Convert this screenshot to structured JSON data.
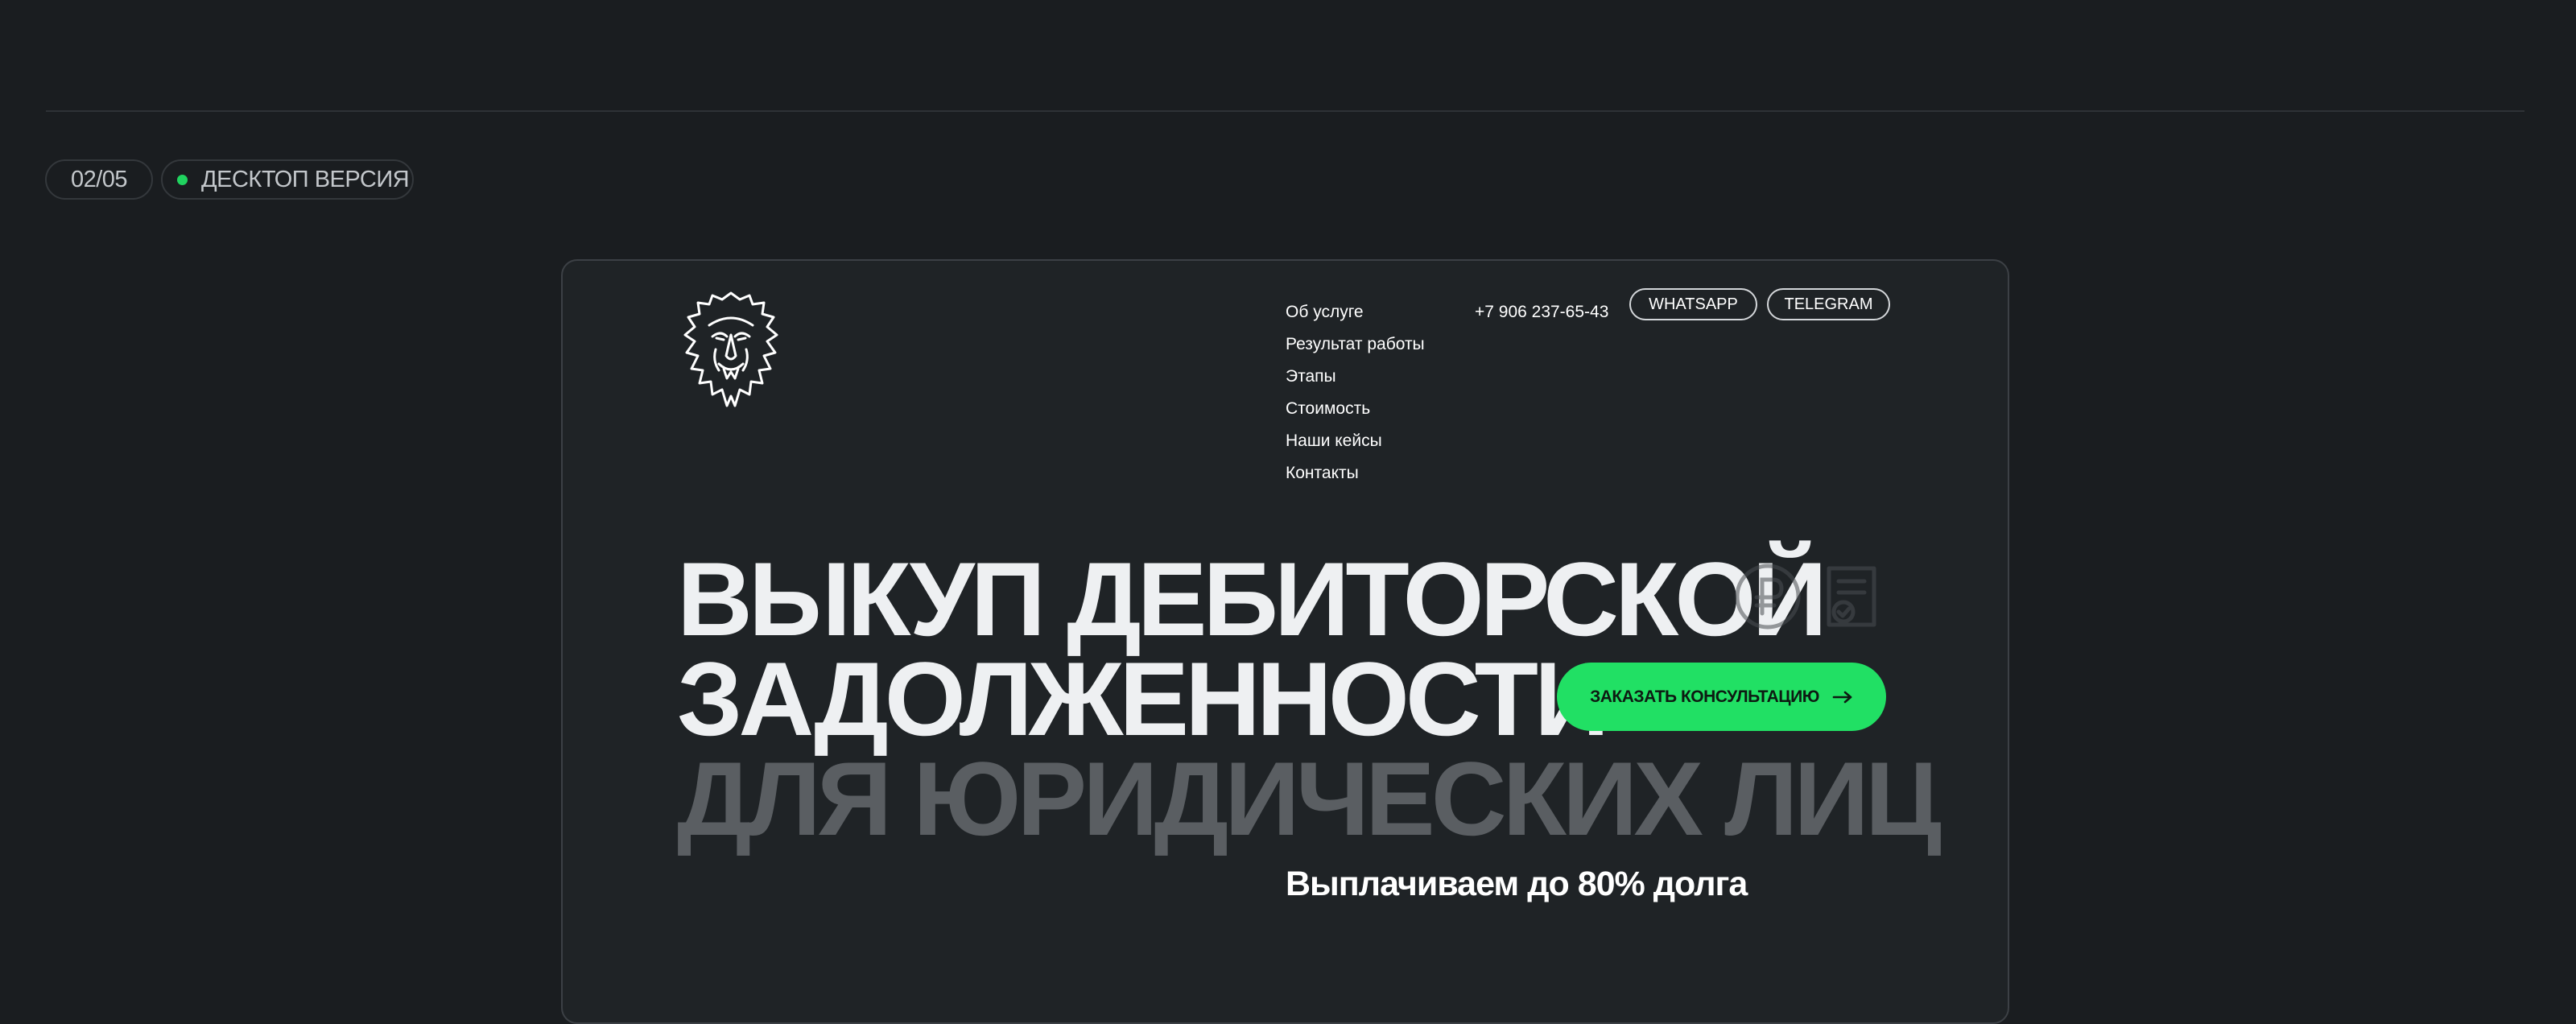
{
  "slide": {
    "counter": "02/05",
    "version_label": "ДЕСКТОП ВЕРСИЯ",
    "status_dot_color": "#20d35f"
  },
  "site": {
    "logo": "lion-head-logo",
    "nav": [
      "Об услуге",
      "Результат работы",
      "Этапы",
      "Стоимость",
      "Наши кейсы",
      "Контакты"
    ],
    "phone": "+7 906 237-65-43",
    "messengers": {
      "whatsapp": "WHATSAPP",
      "telegram": "TELEGRAM"
    },
    "hero": {
      "line1": "ВЫКУП ДЕБИТОРСКОЙ",
      "line2": "ЗАДОЛЖЕННОСТИ",
      "line3": "ДЛЯ ЮРИДИЧЕСКИХ ЛИЦ",
      "cta_label": "ЗАКАЗАТЬ КОНСУЛЬТАЦИЮ",
      "payout_text": "Выплачиваем до 80% долга",
      "icons": [
        "ruble-icon",
        "document-check-icon",
        "arrow-right-icon"
      ]
    },
    "colors": {
      "background": "#1a1d20",
      "frame": "#1f2326",
      "accent": "#21e064",
      "muted_heading": "#5a5e62"
    }
  }
}
